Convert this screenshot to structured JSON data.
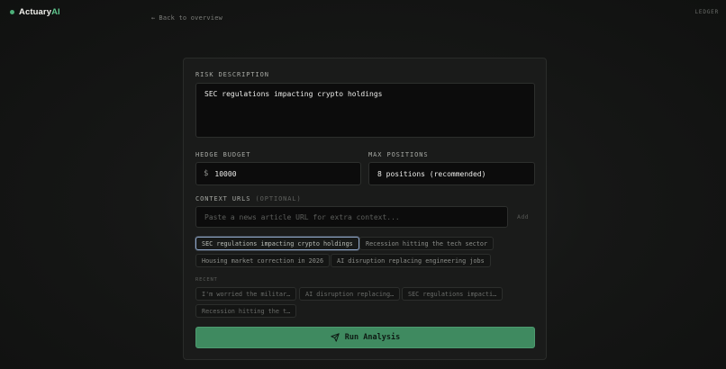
{
  "header": {
    "brand_name": "Actuary",
    "brand_accent": "AI",
    "ledger_link": "LEDGER",
    "back_arrow": "←",
    "back_link": "Back to overview"
  },
  "form": {
    "risk_label": "RISK DESCRIPTION",
    "risk_value": "SEC regulations impacting crypto holdings",
    "budget_label": "HEDGE BUDGET",
    "budget_currency": "$",
    "budget_value": "10000",
    "positions_label": "MAX POSITIONS",
    "positions_value": "8 positions (recommended)",
    "context_label": "CONTEXT URLS",
    "context_optional": "(OPTIONAL)",
    "url_placeholder": "Paste a news article URL for extra context...",
    "add_label": "Add",
    "run_label": "Run Analysis"
  },
  "suggestions": [
    "SEC regulations impacting crypto holdings",
    "Recession hitting the tech sector",
    "Housing market correction in 2026",
    "AI disruption replacing engineering jobs"
  ],
  "recent_label": "RECENT",
  "recent": [
    "I'm worried the militar…",
    "AI disruption replacing…",
    "SEC regulations impacti…",
    "Recession hitting the t…"
  ],
  "colors": {
    "accent": "#5fc48c",
    "run_button": "#3f8a60",
    "selected_chip_border": "#8fa6c8"
  }
}
